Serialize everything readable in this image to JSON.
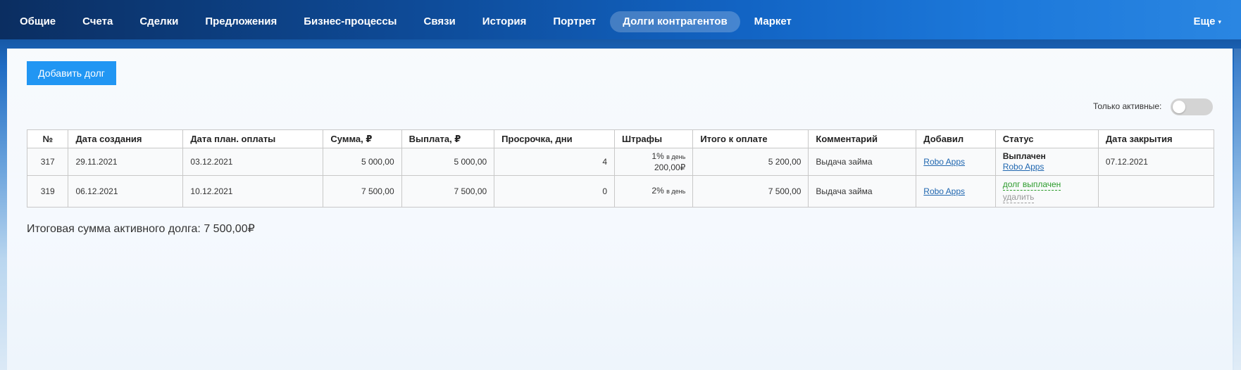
{
  "nav": {
    "items": [
      {
        "label": "Общие"
      },
      {
        "label": "Счета"
      },
      {
        "label": "Сделки"
      },
      {
        "label": "Предложения"
      },
      {
        "label": "Бизнес-процессы"
      },
      {
        "label": "Связи"
      },
      {
        "label": "История"
      },
      {
        "label": "Портрет"
      },
      {
        "label": "Долги контрагентов",
        "active": true
      },
      {
        "label": "Маркет"
      }
    ],
    "more_label": "Еще",
    "more_caret": "▾"
  },
  "toolbar": {
    "add_debt_label": "Добавить долг",
    "only_active_label": "Только активные:"
  },
  "table": {
    "headers": {
      "num": "№",
      "created": "Дата создания",
      "planned": "Дата план. оплаты",
      "amount": "Сумма, ₽",
      "paid": "Выплата, ₽",
      "overdue": "Просрочка, дни",
      "fines": "Штрафы",
      "total": "Итого к оплате",
      "comment": "Комментарий",
      "added_by": "Добавил",
      "status": "Статус",
      "closed": "Дата закрытия"
    },
    "rows": [
      {
        "num": "317",
        "created": "29.11.2021",
        "planned": "03.12.2021",
        "amount": "5 000,00",
        "paid": "5 000,00",
        "overdue": "4",
        "fine_rate": "1%",
        "fine_per_day": "в день",
        "fine_amount": "200,00₽",
        "total": "5 200,00",
        "comment": "Выдача займа",
        "added_by": "Robo Apps",
        "status": "Выплачен",
        "status_by": "Robo Apps",
        "closed": "07.12.2021"
      },
      {
        "num": "319",
        "created": "06.12.2021",
        "planned": "10.12.2021",
        "amount": "7 500,00",
        "paid": "7 500,00",
        "overdue": "0",
        "fine_rate": "2%",
        "fine_per_day": "в день",
        "total": "7 500,00",
        "comment": "Выдача займа",
        "added_by": "Robo Apps",
        "action_paid": "долг выплачен",
        "action_delete": "удалить",
        "closed": ""
      }
    ]
  },
  "summary": {
    "total_active": "Итоговая сумма активного долга: 7 500,00₽"
  }
}
